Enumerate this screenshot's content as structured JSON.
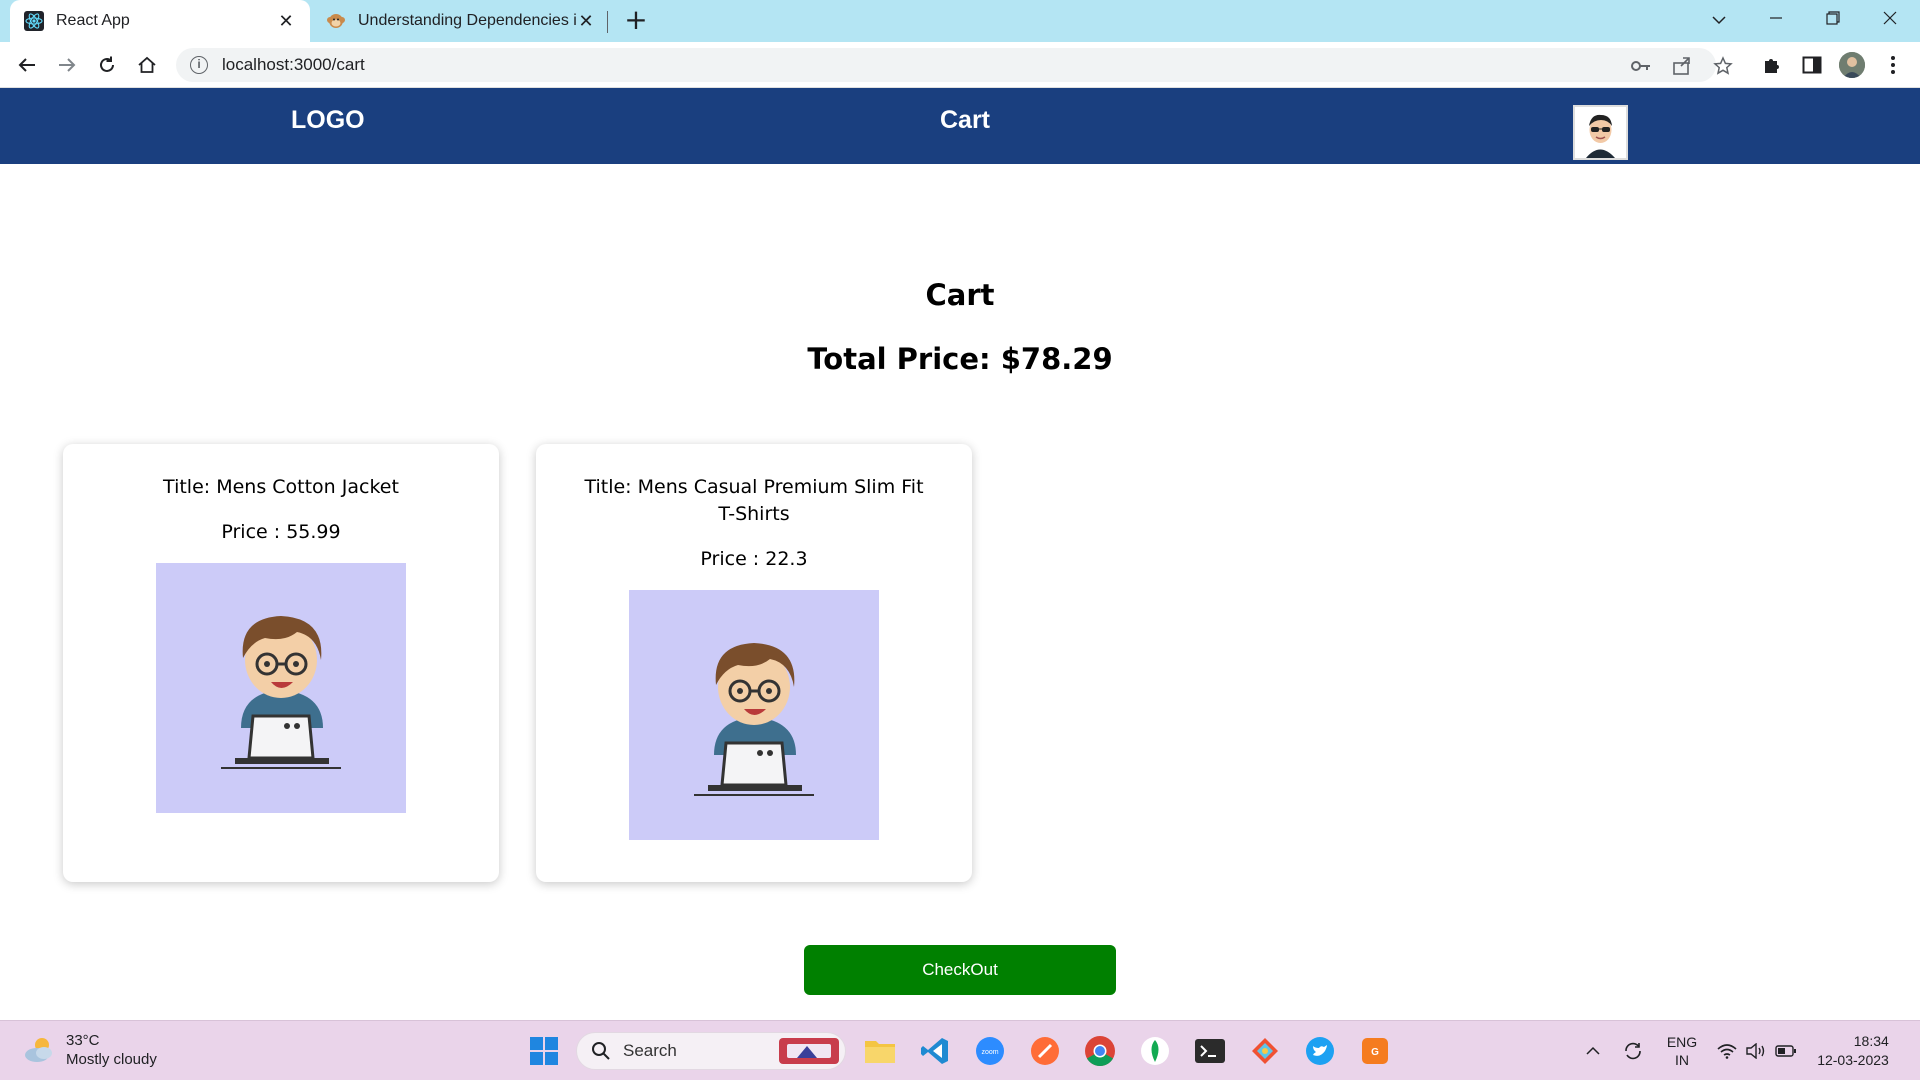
{
  "browser": {
    "tabs": [
      {
        "title": "React App",
        "active": true
      },
      {
        "title": "Understanding Dependencies in",
        "active": false
      }
    ],
    "url": "localhost:3000/cart"
  },
  "header": {
    "logo": "LOGO",
    "title": "Cart"
  },
  "main": {
    "heading": "Cart",
    "total_label": "Total Price: $78.29",
    "items": [
      {
        "title": "Title: Mens Cotton Jacket",
        "price": "Price : 55.99"
      },
      {
        "title": "Title: Mens Casual Premium Slim Fit T-Shirts",
        "price": "Price : 22.3"
      }
    ],
    "checkout_label": "CheckOut"
  },
  "taskbar": {
    "weather_temp": "33°C",
    "weather_desc": "Mostly cloudy",
    "search_label": "Search",
    "lang_top": "ENG",
    "lang_bottom": "IN",
    "time": "18:34",
    "date": "12-03-2023"
  },
  "colors": {
    "header_bg": "#1a3f7f",
    "tabbar_bg": "#b4e5f3",
    "card_image_bg": "#cccbf8",
    "checkout_bg": "#008000",
    "taskbar_bg": "#ead4ea"
  }
}
